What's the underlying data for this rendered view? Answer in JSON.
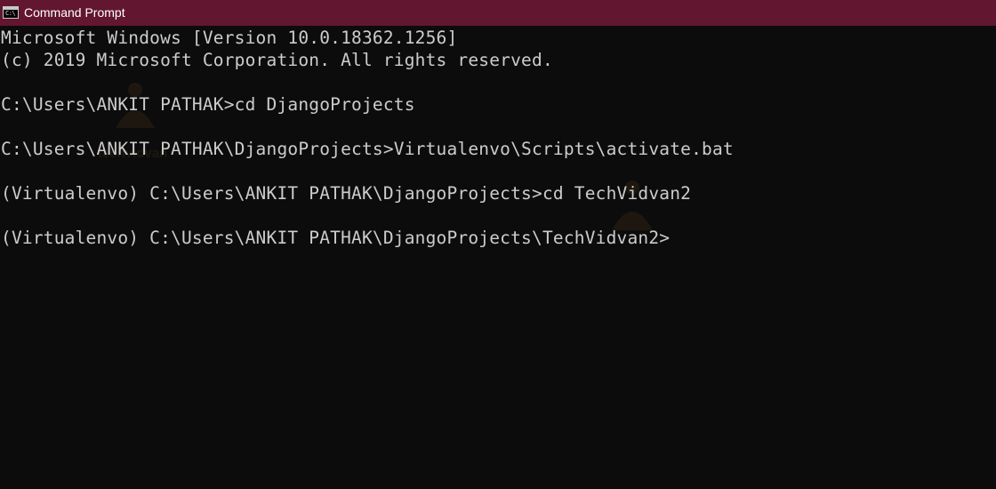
{
  "window": {
    "title": "Command Prompt",
    "icon": "cmd-icon",
    "titlebar_color": "#63162f"
  },
  "console": {
    "background": "#0c0c0c",
    "text_color": "#cccccc",
    "lines": [
      "Microsoft Windows [Version 10.0.18362.1256]",
      "(c) 2019 Microsoft Corporation. All rights reserved.",
      "C:\\Users\\ANKIT PATHAK>cd DjangoProjects",
      "C:\\Users\\ANKIT PATHAK\\DjangoProjects>Virtualenvo\\Scripts\\activate.bat",
      "(Virtualenvo) C:\\Users\\ANKIT PATHAK\\DjangoProjects>cd TechVidvan2",
      "(Virtualenvo) C:\\Users\\ANKIT PATHAK\\DjangoProjects\\TechVidvan2>"
    ]
  },
  "watermark": {
    "text": "techvidvan"
  }
}
